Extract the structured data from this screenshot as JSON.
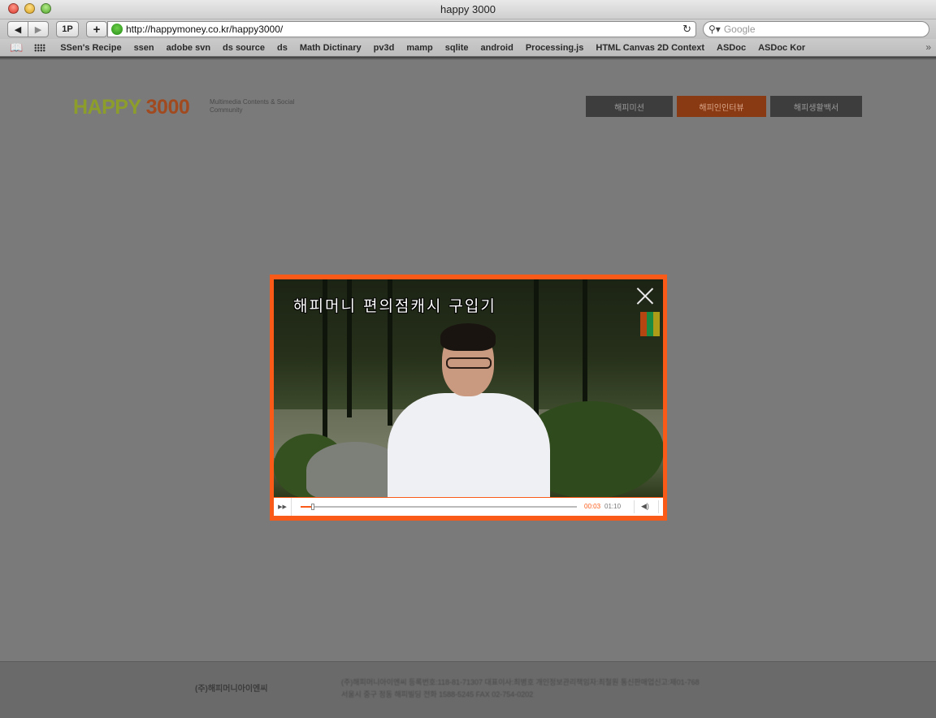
{
  "window": {
    "title": "happy 3000"
  },
  "toolbar": {
    "one_p_label": "1P",
    "add_label": "+",
    "url": "http://happymoney.co.kr/happy3000/",
    "search_placeholder": "Google"
  },
  "bookmarks": {
    "items": [
      "SSen's Recipe",
      "ssen",
      "adobe svn",
      "ds source",
      "ds",
      "Math Dictinary",
      "pv3d",
      "mamp",
      "sqlite",
      "android",
      "Processing.js",
      "HTML Canvas 2D Context",
      "ASDoc",
      "ASDoc Kor"
    ]
  },
  "page": {
    "logo_part1": "HAPPY",
    "logo_part2": "3000",
    "logo_sub": "Multimedia Contents & Social Community",
    "nav": [
      "해피미션",
      "해피인인터뷰",
      "해피생활백서"
    ],
    "footer_brand": "(주)해피머니아이엔씨",
    "footer_info": [
      "(주)해피머니아이엔씨 등록번호:118-81-71307 대표이사:최병호 개인정보관리책임자:최철원 통신판매업신고:제01-768",
      "서울시 중구 정동 해피빌딩 전화 1588-5245 FAX 02-754-0202"
    ]
  },
  "player": {
    "subtitle": "해피머니 편의점캐시 구입기",
    "time_current": "00:03",
    "time_total": "01:10",
    "progress": 0.043,
    "colors": {
      "border": "#fa5a17",
      "accent": "#fa5a17"
    }
  },
  "icons": {
    "back": "left-arrow-icon",
    "forward": "right-arrow-icon",
    "reload": "reload-icon",
    "search": "magnifier-icon",
    "bookmarks_book": "book-icon",
    "top_sites": "grid-icon",
    "more": "chevron-double-right-icon",
    "play": "play-icon",
    "volume": "speaker-icon",
    "close": "close-icon"
  }
}
